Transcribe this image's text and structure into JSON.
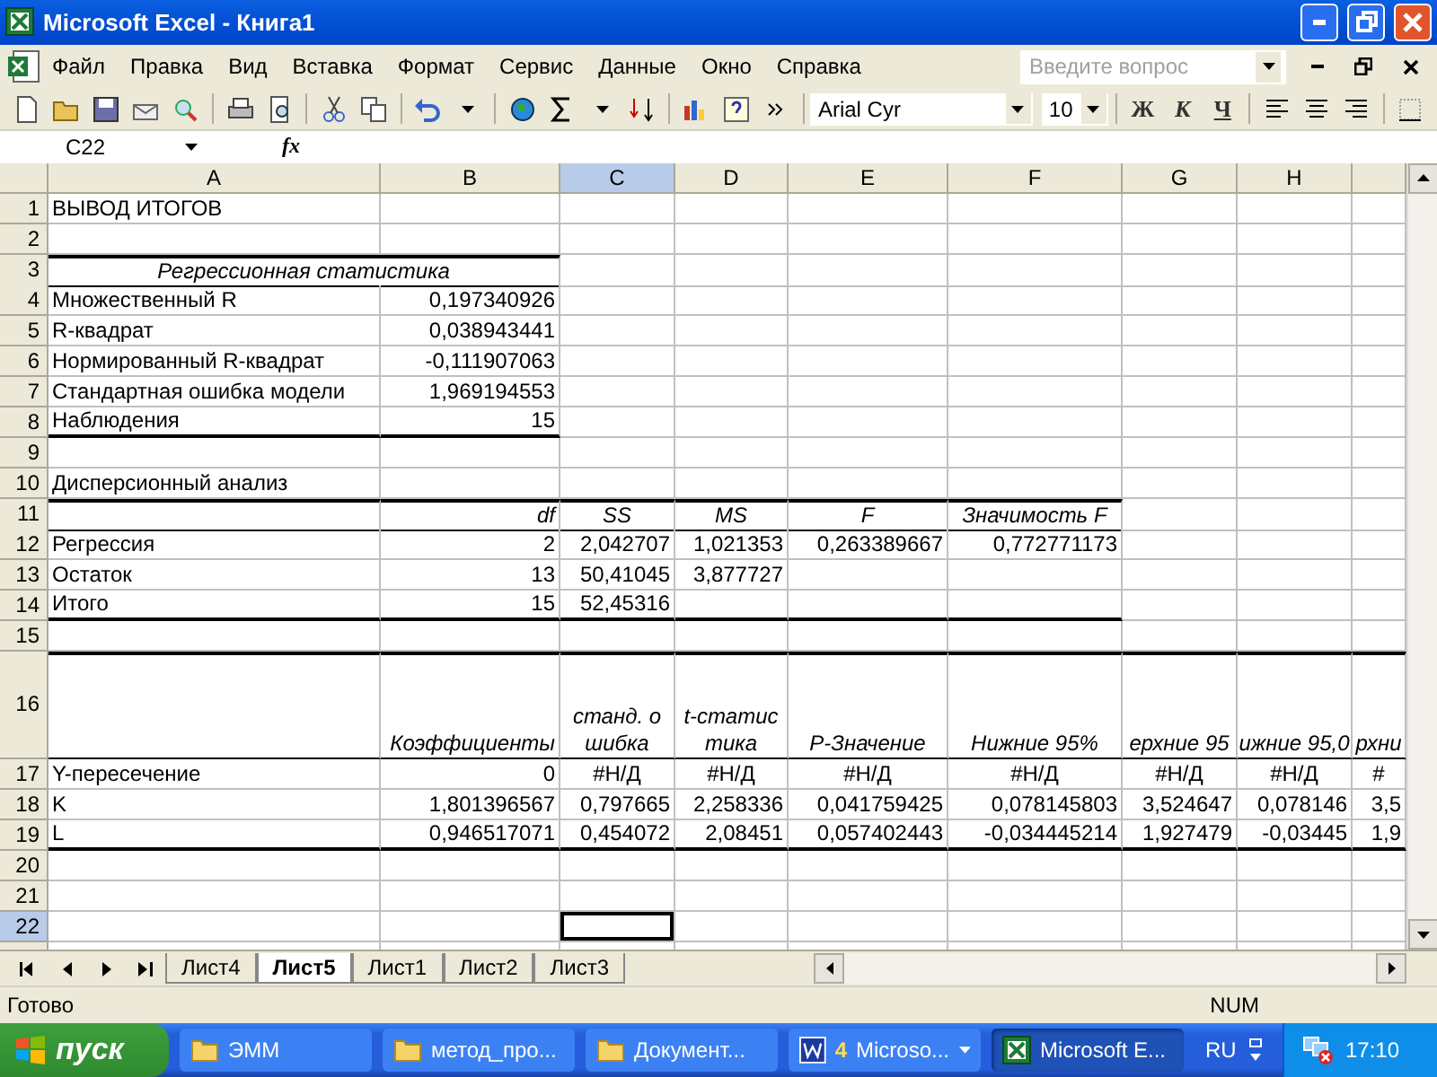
{
  "window": {
    "title": "Microsoft Excel - Книга1"
  },
  "menu": [
    "Файл",
    "Правка",
    "Вид",
    "Вставка",
    "Формат",
    "Сервис",
    "Данные",
    "Окно",
    "Справка"
  ],
  "help_field": {
    "placeholder": "Введите вопрос"
  },
  "formatting": {
    "font": "Arial Cyr",
    "size": "10",
    "bold_key": "Ж",
    "italic_key": "К",
    "underline_key": "Ч"
  },
  "formula_bar": {
    "name_box": "C22",
    "fx": "fx"
  },
  "sheet": {
    "columns": [
      {
        "label": "A",
        "selected": false
      },
      {
        "label": "B",
        "selected": false
      },
      {
        "label": "C",
        "selected": true
      },
      {
        "label": "D",
        "selected": false
      },
      {
        "label": "E",
        "selected": false
      },
      {
        "label": "F",
        "selected": false
      },
      {
        "label": "G",
        "selected": false
      },
      {
        "label": "H",
        "selected": false
      }
    ],
    "rows": [
      {
        "kind": "row",
        "number": "1",
        "selected": false,
        "label": "ВЫВОД ИТОГОВ"
      },
      {
        "kind": "row",
        "number": "2",
        "selected": false
      },
      {
        "kind": "table",
        "caption": {
          "number": "3",
          "selected": false,
          "label": "Регрессионная статистика"
        },
        "rows": [
          {
            "number": "4",
            "selected": false,
            "label": "Множественный R",
            "values": [
              "0,197340926"
            ]
          },
          {
            "number": "5",
            "selected": false,
            "label": "R-квадрат",
            "values": [
              "0,038943441"
            ]
          },
          {
            "number": "6",
            "selected": false,
            "label": "Нормированный R-квадрат",
            "values": [
              "-0,111907063"
            ]
          },
          {
            "number": "7",
            "selected": false,
            "label": "Стандартная ошибка модели",
            "values": [
              "1,969194553"
            ]
          },
          {
            "number": "8",
            "selected": false,
            "label": "Наблюдения",
            "values": [
              "15"
            ]
          }
        ]
      },
      {
        "kind": "row",
        "number": "9",
        "selected": false
      },
      {
        "kind": "row",
        "number": "10",
        "selected": false,
        "label": "Дисперсионный анализ"
      },
      {
        "kind": "table",
        "header": {
          "number": "11",
          "selected": false,
          "values": [
            "df",
            "SS",
            "MS",
            "F",
            "Значимость F"
          ]
        },
        "rows": [
          {
            "number": "12",
            "selected": false,
            "label": "Регрессия",
            "values": [
              "2",
              "2,042707",
              "1,021353",
              "0,263389667",
              "0,772771173"
            ]
          },
          {
            "number": "13",
            "selected": false,
            "label": "Остаток",
            "values": [
              "13",
              "50,41045",
              "3,877727"
            ]
          },
          {
            "number": "14",
            "selected": false,
            "label": "Итого",
            "values": [
              "15",
              "52,45316"
            ]
          }
        ]
      },
      {
        "kind": "row",
        "number": "15",
        "selected": false
      },
      {
        "kind": "table",
        "header": {
          "number": "16",
          "selected": false,
          "values": [
            "Коэффициенты",
            {
              "text": "станд. ошибка",
              "wrap": true
            },
            {
              "text": "t-статистика",
              "wrap": true
            },
            "P-Значение",
            "Нижние 95%",
            "ерхние 95",
            "ижние 95,0",
            "рхни"
          ]
        },
        "rows": [
          {
            "number": "17",
            "selected": false,
            "label": "Y-пересечение",
            "values": [
              "0",
              {
                "text": "#Н/Д",
                "kind": "error"
              },
              {
                "text": "#Н/Д",
                "kind": "error"
              },
              {
                "text": "#Н/Д",
                "kind": "error"
              },
              {
                "text": "#Н/Д",
                "kind": "error"
              },
              {
                "text": "#Н/Д",
                "kind": "error"
              },
              {
                "text": "#Н/Д",
                "kind": "error"
              },
              {
                "text": "#",
                "kind": "error"
              }
            ]
          },
          {
            "number": "18",
            "selected": false,
            "label": "K",
            "values": [
              "1,801396567",
              "0,797665",
              "2,258336",
              "0,041759425",
              "0,078145803",
              "3,524647",
              "0,078146",
              "3,5"
            ]
          },
          {
            "number": "19",
            "selected": false,
            "label": "L",
            "values": [
              "0,946517071",
              "0,454072",
              "2,08451",
              "0,057402443",
              "-0,034445214",
              "1,927479",
              "-0,03445",
              "1,9"
            ]
          }
        ]
      },
      {
        "kind": "row",
        "number": "20",
        "selected": false
      },
      {
        "kind": "row",
        "number": "21",
        "selected": false
      },
      {
        "kind": "row",
        "number": "22",
        "selected": true
      }
    ]
  },
  "sheet_tabs": [
    {
      "label": "Лист4",
      "selected": false
    },
    {
      "label": "Лист5",
      "selected": true
    },
    {
      "label": "Лист1",
      "selected": false
    },
    {
      "label": "Лист2",
      "selected": false
    },
    {
      "label": "Лист3",
      "selected": false
    }
  ],
  "status_bar": {
    "message": "Готово",
    "indicator": "NUM"
  },
  "taskbar": {
    "start": "пуск",
    "items": [
      {
        "kind": "folder",
        "label": "ЭММ",
        "selected": false
      },
      {
        "kind": "folder",
        "label": "метод_про...",
        "selected": false
      },
      {
        "kind": "folder",
        "label": "Документ...",
        "selected": false
      },
      {
        "kind": "word",
        "count": "4",
        "label": "Microso...",
        "selected": false
      },
      {
        "kind": "excel",
        "label": "Microsoft E...",
        "selected": true
      }
    ],
    "language": "RU",
    "time": "17:10"
  }
}
